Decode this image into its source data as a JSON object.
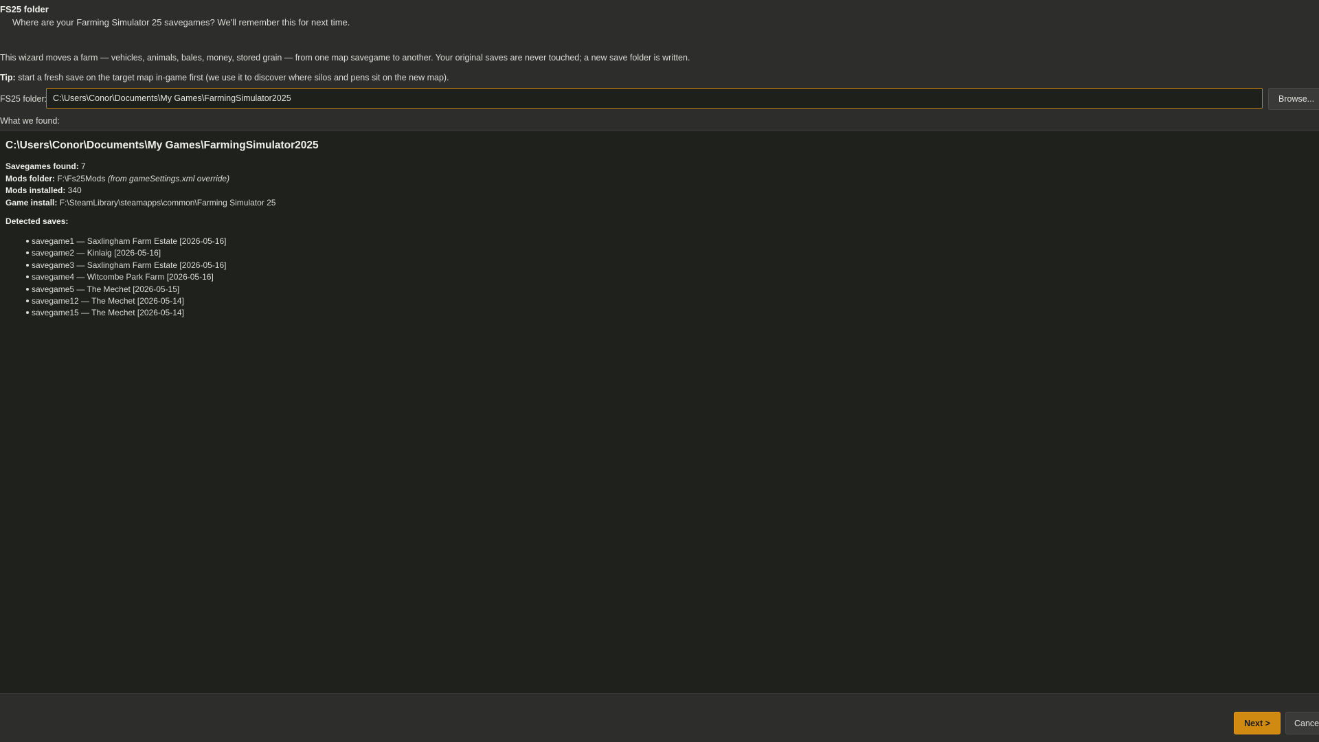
{
  "header": {
    "title": "FS25 folder",
    "subtitle": "Where are your Farming Simulator 25 savegames? We'll remember this for next time."
  },
  "intro": "This wizard moves a farm — vehicles, animals, bales, money, stored grain — from one map savegame to another. Your original saves are never touched; a new save folder is written.",
  "tip": {
    "label": "Tip:",
    "text": " start a fresh save on the target map in-game first (we use it to discover where silos and pens sit on the new map)."
  },
  "folder": {
    "label": "FS25 folder:",
    "value": "C:\\Users\\Conor\\Documents\\My Games\\FarmingSimulator2025",
    "browse_label": "Browse..."
  },
  "results": {
    "heading": "What we found:",
    "path": "C:\\Users\\Conor\\Documents\\My Games\\FarmingSimulator2025",
    "savegames_label": "Savegames found:",
    "savegames_value": " 7",
    "mods_folder_label": "Mods folder:",
    "mods_folder_value": " F:\\Fs25Mods ",
    "mods_folder_note": "(from gameSettings.xml override)",
    "mods_installed_label": "Mods installed:",
    "mods_installed_value": " 340",
    "game_install_label": "Game install:",
    "game_install_value": " F:\\SteamLibrary\\steamapps\\common\\Farming Simulator 25",
    "detected_heading": "Detected saves:",
    "saves": [
      "savegame1 — Saxlingham Farm Estate [2026-05-16]",
      "savegame2 — Kinlaig [2026-05-16]",
      "savegame3 — Saxlingham Farm Estate [2026-05-16]",
      "savegame4 — Witcombe Park Farm [2026-05-16]",
      "savegame5 — The Mechet [2026-05-15]",
      "savegame12 — The Mechet [2026-05-14]",
      "savegame15 — The Mechet [2026-05-14]"
    ]
  },
  "footer": {
    "next_label": "Next >",
    "cancel_label": "Cancel"
  },
  "colors": {
    "background": "#2d2e2b",
    "panel": "#1f211d",
    "accent": "#d08a12",
    "text": "#dcdcd6"
  }
}
